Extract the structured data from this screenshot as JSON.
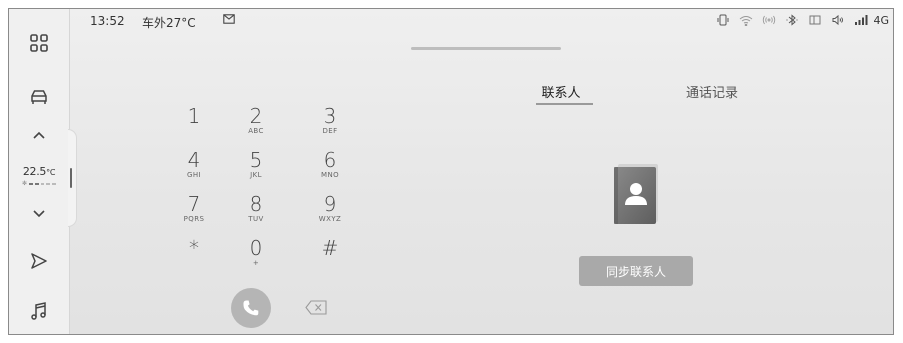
{
  "status": {
    "time": "13:52",
    "outside_temp": "车外27°C",
    "network": "4G"
  },
  "sidebar": {
    "temperature": {
      "value": "22.5",
      "unit": "°C"
    },
    "fan_level": 0.3,
    "icons": [
      "apps-grid-icon",
      "car-icon",
      "chevron-up-icon",
      "chevron-down-icon",
      "navigation-icon",
      "music-icon"
    ]
  },
  "dialpad": {
    "keys": [
      {
        "digit": "1",
        "letters": ""
      },
      {
        "digit": "2",
        "letters": "ABC"
      },
      {
        "digit": "3",
        "letters": "DEF"
      },
      {
        "digit": "4",
        "letters": "GHI"
      },
      {
        "digit": "5",
        "letters": "JKL"
      },
      {
        "digit": "6",
        "letters": "MNO"
      },
      {
        "digit": "7",
        "letters": "PQRS"
      },
      {
        "digit": "8",
        "letters": "TUV"
      },
      {
        "digit": "9",
        "letters": "WXYZ"
      },
      {
        "digit": "*",
        "letters": ""
      },
      {
        "digit": "0",
        "letters": "+"
      },
      {
        "digit": "#",
        "letters": ""
      }
    ]
  },
  "tabs": {
    "contacts": "联系人",
    "history": "通话记录"
  },
  "contacts_panel": {
    "sync_label": "同步联系人"
  },
  "colors": {
    "background": "#e9e9e9",
    "call_button": "#b5b5b5",
    "sync_button": "#a9a9a9"
  }
}
